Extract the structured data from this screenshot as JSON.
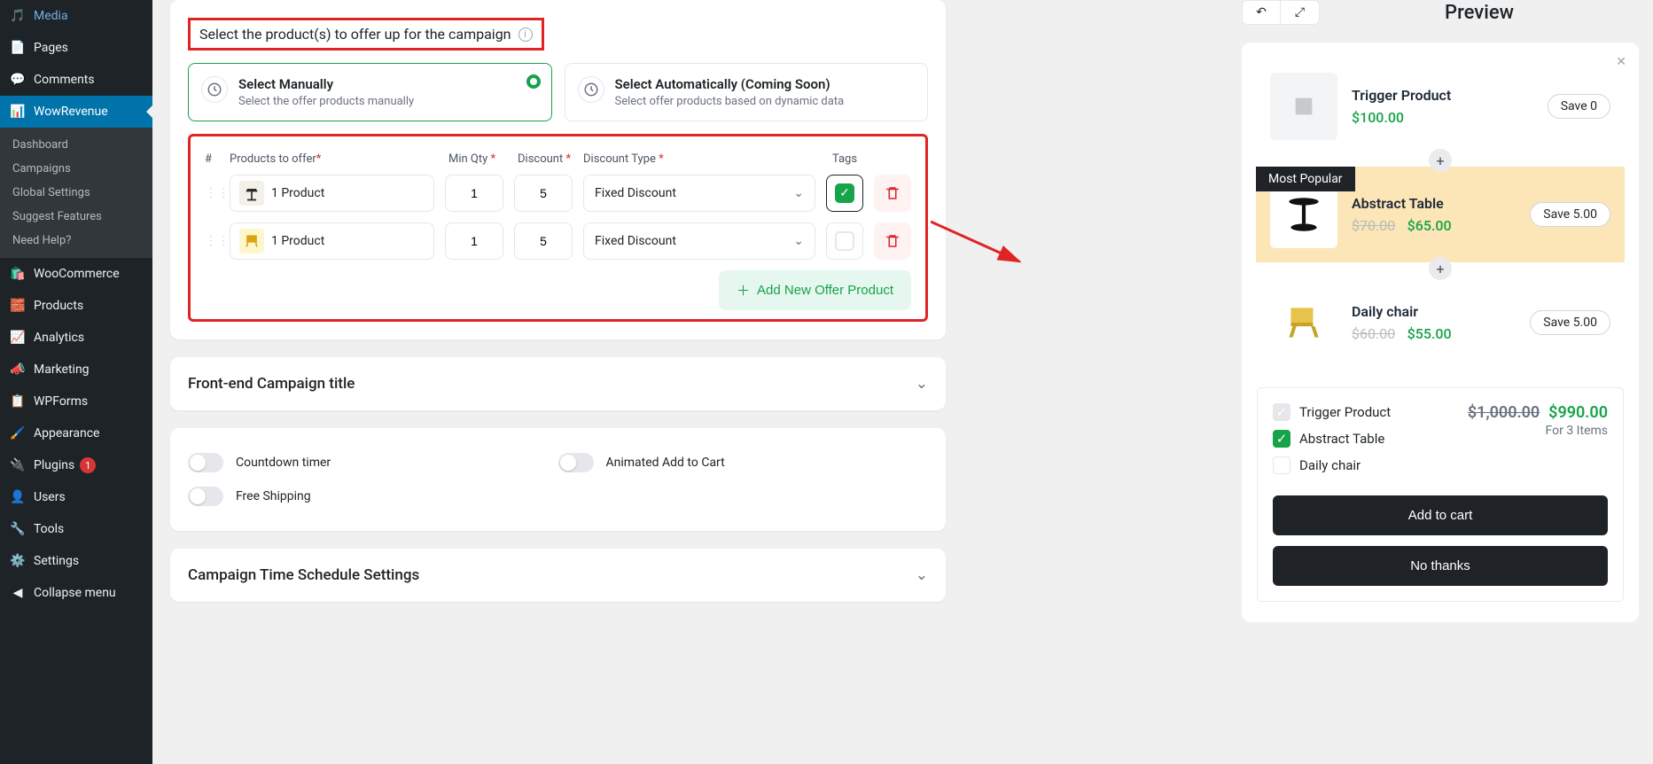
{
  "sidebar": {
    "items": [
      {
        "label": "Media"
      },
      {
        "label": "Pages"
      },
      {
        "label": "Comments"
      },
      {
        "label": "WowRevenue"
      },
      {
        "label": "WooCommerce"
      },
      {
        "label": "Products"
      },
      {
        "label": "Analytics"
      },
      {
        "label": "Marketing"
      },
      {
        "label": "WPForms"
      },
      {
        "label": "Appearance"
      },
      {
        "label": "Plugins",
        "badge": "1"
      },
      {
        "label": "Users"
      },
      {
        "label": "Tools"
      },
      {
        "label": "Settings"
      }
    ],
    "sub": [
      "Dashboard",
      "Campaigns",
      "Global Settings",
      "Suggest Features",
      "Need Help?"
    ],
    "collapse": "Collapse menu"
  },
  "section": {
    "title": "Select the product(s) to offer up for the campaign",
    "opt1": {
      "title": "Select Manually",
      "sub": "Select the offer products manually"
    },
    "opt2": {
      "title": "Select Automatically (Coming Soon)",
      "sub": "Select offer products based on dynamic data"
    }
  },
  "table": {
    "head": {
      "hash": "#",
      "prod": "Products to offer",
      "qty": "Min Qty",
      "disc": "Discount",
      "dtype": "Discount Type",
      "tags": "Tags"
    },
    "rows": [
      {
        "prod": "1 Product",
        "qty": "1",
        "disc": "5",
        "dtype": "Fixed Discount",
        "tagged": true
      },
      {
        "prod": "1 Product",
        "qty": "1",
        "disc": "5",
        "dtype": "Fixed Discount",
        "tagged": false
      }
    ],
    "add": "Add New Offer Product"
  },
  "accordion1": "Front-end Campaign title",
  "toggles": {
    "countdown": "Countdown timer",
    "animated": "Animated Add to Cart",
    "shipping": "Free Shipping"
  },
  "accordion2": "Campaign Time Schedule Settings",
  "preview": {
    "title": "Preview",
    "trigger": {
      "name": "Trigger Product",
      "price": "$100.00",
      "save": "Save 0"
    },
    "items": [
      {
        "name": "Abstract Table",
        "old": "$70.00",
        "new": "$65.00",
        "save": "Save 5.00",
        "badge": "Most Popular",
        "highlight": true
      },
      {
        "name": "Daily chair",
        "old": "$60.00",
        "new": "$55.00",
        "save": "Save 5.00"
      }
    ],
    "summary": {
      "list": [
        {
          "label": "Trigger Product",
          "state": "grey"
        },
        {
          "label": "Abstract Table",
          "state": "green"
        },
        {
          "label": "Daily chair",
          "state": "white"
        }
      ],
      "old": "$1,000.00",
      "new": "$990.00",
      "for": "For 3 Items",
      "add": "Add to cart",
      "no": "No thanks"
    }
  }
}
